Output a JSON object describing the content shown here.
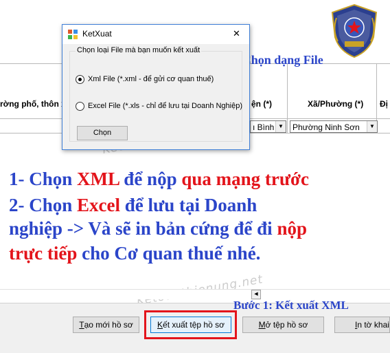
{
  "dialog": {
    "title": "KetXuat",
    "group_label": "Chọn loại File mà bạn muốn kết xuất",
    "options": [
      {
        "label": "Xml File (*.xml - để gửi cơ quan thuế)",
        "selected": true
      },
      {
        "label": "Excel File (*.xls - chỉ để lưu tại Doanh Nghiệp)",
        "selected": false
      }
    ],
    "choose_button": "Chọn",
    "close_symbol": "✕"
  },
  "form": {
    "col_street": "rờng phố, thôn x",
    "col_district": "ện (*)",
    "col_ward": "Xã/Phường (*)",
    "col_extra": "Đị",
    "district_value": "ı Bình",
    "ward_value": "Phường Ninh Sơn"
  },
  "annotations": {
    "step2": "Bước 2: Chọn dạng File",
    "step1": "Bước 1: Kết xuất XML",
    "line1_a": "1- Chọn ",
    "line1_b": "XML",
    "line1_c": " để nộp ",
    "line1_d": "qua mạng trước",
    "line2_a": "2- Chọn ",
    "line2_b": "Excel",
    "line2_c": " để lưu tại Doanh",
    "line3_a": "nghiệp -> Và sẽ in bản cứng để đi ",
    "line3_b": "nộp",
    "line4_a": "trực tiếp",
    "line4_b": " cho Cơ quan thuế nhé.",
    "watermark": "Ketoanthienung.net"
  },
  "buttons": {
    "new_first": "T",
    "new_rest": "ạo mới hồ sơ",
    "export_first": "K",
    "export_rest": "ết xuất tệp hồ sơ",
    "open_first": "M",
    "open_rest": "ở tệp hồ sơ",
    "print_first": "I",
    "print_rest": "n tờ khai"
  },
  "colors": {
    "annotation_blue": "#2b45c9",
    "annotation_red": "#e3141b",
    "highlight_box": "#e3141b",
    "dialog_border": "#3f7fd7"
  },
  "icons": [
    "app-icon",
    "close-icon",
    "dropdown-arrow-icon",
    "scroll-arrow-left-icon",
    "company-logo"
  ]
}
